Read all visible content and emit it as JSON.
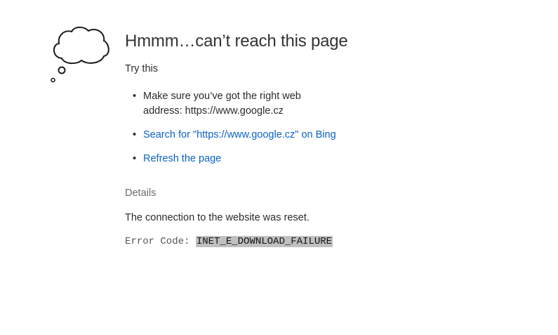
{
  "error_page": {
    "icon": "thought-cloud-icon",
    "title": "Hmmm…can’t reach this page",
    "try_this": "Try this",
    "suggestions": [
      {
        "text": "Make sure you’ve got the right web address: https://www.google.cz",
        "is_link": false
      },
      {
        "text": "Search for \"https://www.google.cz\" on Bing",
        "is_link": true
      },
      {
        "text": "Refresh the page",
        "is_link": true
      }
    ],
    "details_label": "Details",
    "details_message": "The connection to the website was reset.",
    "error_code_label": "Error Code:",
    "error_code_value": "INET_E_DOWNLOAD_FAILURE"
  },
  "colors": {
    "link": "#0b62c7",
    "title": "#333333",
    "details": "#6b6b6b",
    "error_code_highlight": "#c0c0c0"
  }
}
